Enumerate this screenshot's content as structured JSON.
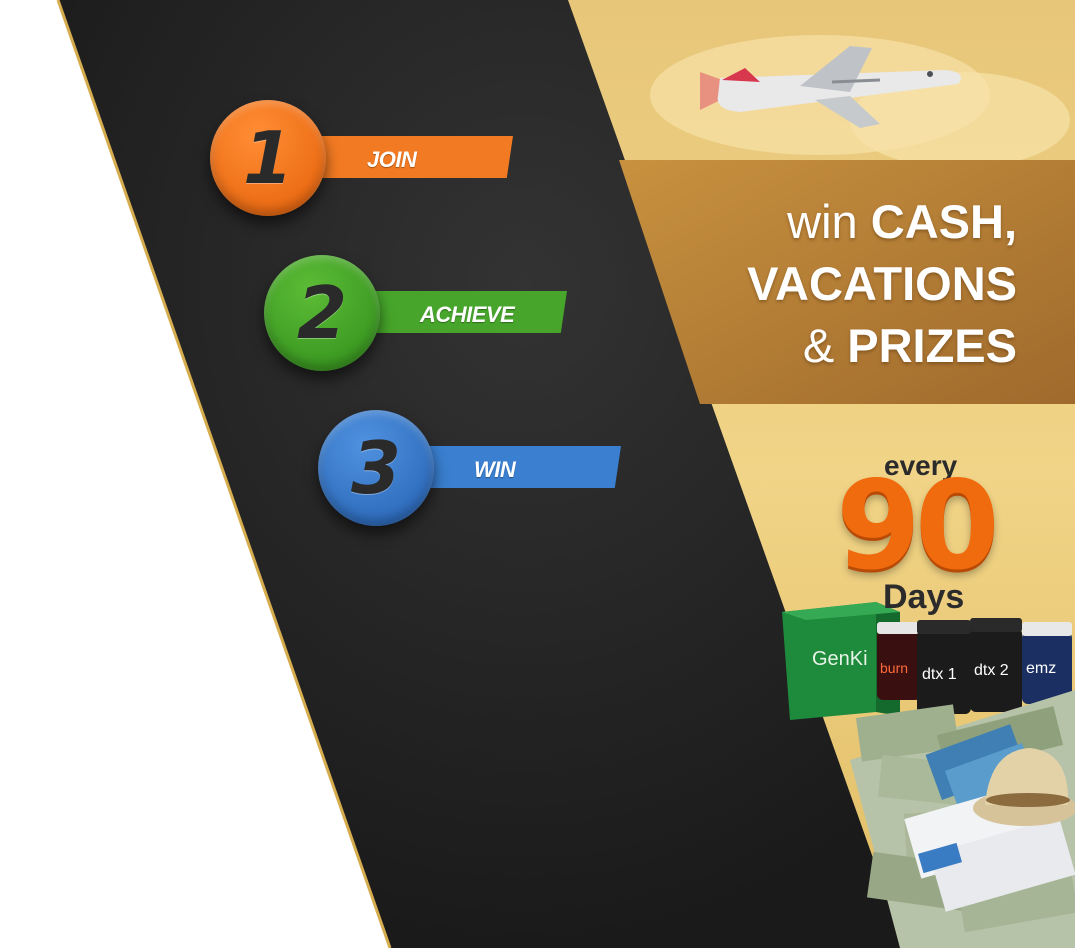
{
  "steps": [
    {
      "number": "1",
      "label": "JOIN",
      "color": "#f06a10",
      "ribbon_color": "#f27a22"
    },
    {
      "number": "2",
      "label": "ACHIEVE",
      "color": "#3d9a22",
      "ribbon_color": "#46a52a"
    },
    {
      "number": "3",
      "label": "WIN",
      "color": "#2f74c8",
      "ribbon_color": "#3a7fd0"
    }
  ],
  "prize": {
    "line1_prefix": "win ",
    "line1_bold": "CASH,",
    "line2": "VACATIONS",
    "line3_prefix": "& ",
    "line3_bold": "PRIZES"
  },
  "promo": {
    "every": "every",
    "number": "90",
    "days": "Days"
  },
  "products": {
    "box": "GenKi",
    "bottle1": "burn",
    "bottle2": "dtx 1",
    "bottle3": "dtx 2",
    "bottle4": "emz"
  },
  "colors": {
    "dark_band": "#1f1f1f",
    "gold_background": "#e4c16c",
    "brown_panel": "#b07a35",
    "accent_orange": "#f06a0e"
  }
}
